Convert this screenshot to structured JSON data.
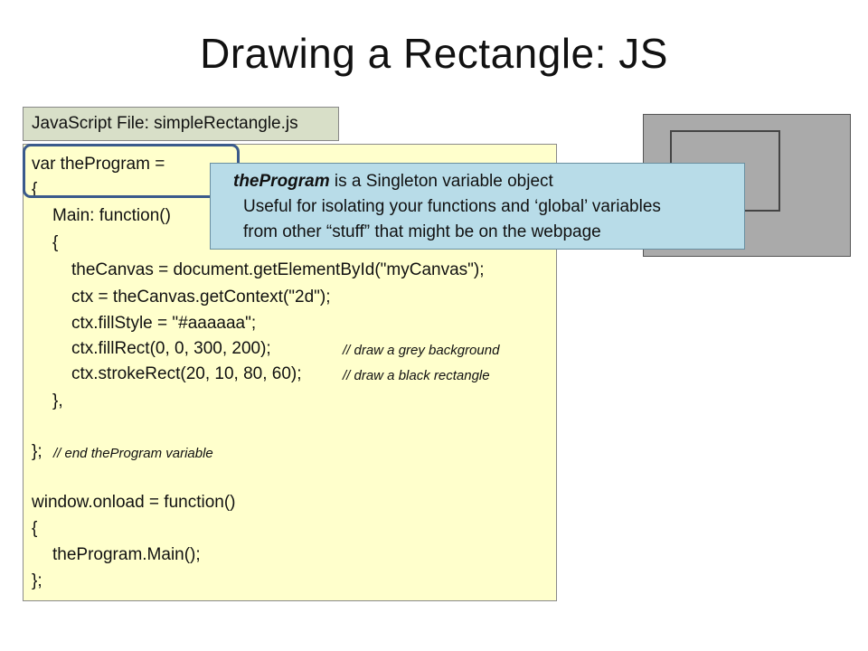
{
  "slide": {
    "title": "Drawing a Rectangle: JS"
  },
  "file_label": "JavaScript File: simpleRectangle.js",
  "code": {
    "lines": [
      {
        "text": "var theProgram =",
        "comment": ""
      },
      {
        "text": "{",
        "comment": ""
      },
      {
        "text": "Main: function()",
        "comment": ""
      },
      {
        "text": "{",
        "comment": ""
      },
      {
        "text": "theCanvas = document.getElementById(\"myCanvas\");",
        "comment": ""
      },
      {
        "text": "ctx = theCanvas.getContext(\"2d\");",
        "comment": ""
      },
      {
        "text": "ctx.fillStyle = \"#aaaaaa\";",
        "comment": ""
      },
      {
        "text": "ctx.fillRect(0, 0, 300, 200);",
        "comment": "// draw a grey background"
      },
      {
        "text": "ctx.strokeRect(20, 10, 80, 60);",
        "comment": "// draw a black rectangle"
      },
      {
        "text": "},",
        "comment": ""
      },
      {
        "text": "};",
        "comment": "// end theProgram variable"
      },
      {
        "text": "window.onload = function()",
        "comment": ""
      },
      {
        "text": "{",
        "comment": ""
      },
      {
        "text": "theProgram.Main();",
        "comment": ""
      },
      {
        "text": "};",
        "comment": ""
      }
    ]
  },
  "callout": {
    "term": "theProgram",
    "line1_rest": " is a Singleton variable object",
    "line2": "Useful for isolating your functions and ‘global’ variables",
    "line3": "from other “stuff” that might be on the webpage"
  },
  "colors": {
    "code_background": "#ffffcc",
    "file_label_background": "#d8dfc8",
    "callout_background": "#b8dce8",
    "highlight_border": "#3a5a8c",
    "canvas_fill": "#aaaaaa"
  }
}
